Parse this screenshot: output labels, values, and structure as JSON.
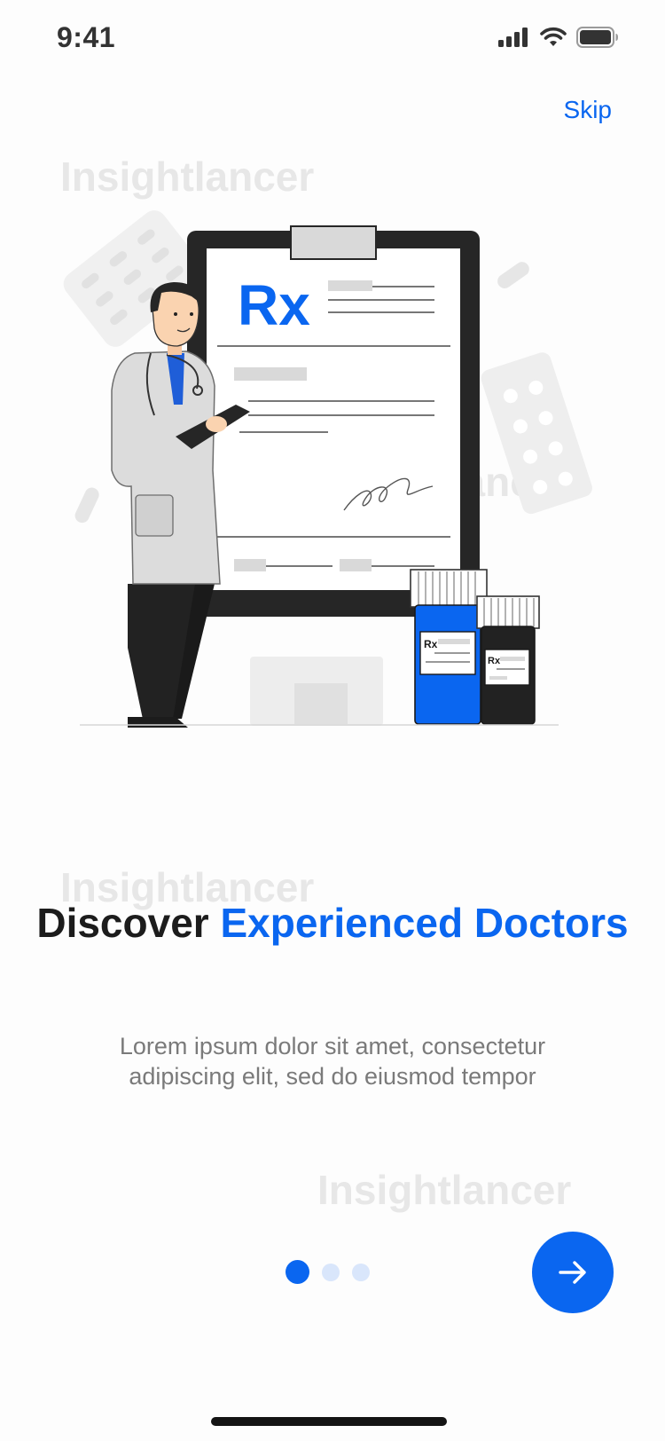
{
  "status_bar": {
    "time": "9:41",
    "icons": [
      "cellular-signal-icon",
      "wifi-icon",
      "battery-icon"
    ]
  },
  "header": {
    "skip_label": "Skip"
  },
  "watermarks": [
    "Insightlancer",
    "Insightlancer",
    "Insightlancer",
    "Insightlancer"
  ],
  "illustration": {
    "prescription_symbol": "Rx",
    "bottle_labels": [
      "Rx",
      "Rx"
    ]
  },
  "content": {
    "title_part1": "Discover ",
    "title_part2": "Experienced Doctors",
    "subtitle": "Lorem ipsum dolor sit amet, consectetur adipiscing elit, sed do eiusmod tempor"
  },
  "pagination": {
    "total": 3,
    "active_index": 0
  },
  "navigation": {
    "next_icon": "arrow-right-icon"
  },
  "colors": {
    "accent": "#0a66f0",
    "text_dark": "#1c1c1c",
    "text_muted": "#7a7a7a",
    "dot_inactive": "#d9e6fb"
  }
}
